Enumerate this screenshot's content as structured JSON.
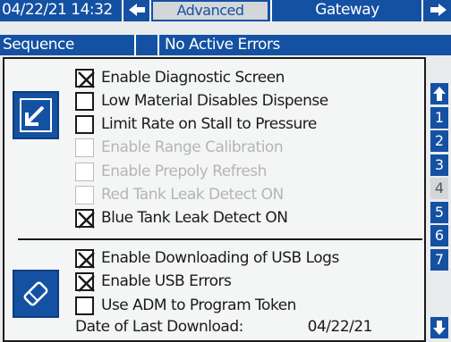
{
  "header": {
    "datetime": "04/22/21 14:32",
    "tab_active": "Advanced",
    "tab_next": "Gateway",
    "back_icon": "arrow-left-icon",
    "forward_icon": "arrow-right-icon"
  },
  "status": {
    "mode": "Sequence",
    "errors": "No Active Errors"
  },
  "settings": [
    {
      "label": "Enable Diagnostic Screen",
      "checked": true,
      "enabled": true
    },
    {
      "label": "Low Material Disables Dispense",
      "checked": false,
      "enabled": true
    },
    {
      "label": "Limit Rate on Stall to Pressure",
      "checked": false,
      "enabled": true
    },
    {
      "label": "Enable Range Calibration",
      "checked": false,
      "enabled": false
    },
    {
      "label": "Enable Prepoly Refresh",
      "checked": false,
      "enabled": false
    },
    {
      "label": "Red Tank Leak Detect ON",
      "checked": false,
      "enabled": false
    },
    {
      "label": "Blue Tank Leak Detect ON",
      "checked": true,
      "enabled": true
    },
    {
      "label": "Enable Downloading of USB Logs",
      "checked": true,
      "enabled": true
    },
    {
      "label": "Enable USB Errors",
      "checked": true,
      "enabled": true
    },
    {
      "label": "Use ADM to Program Token",
      "checked": false,
      "enabled": true
    }
  ],
  "last_download": {
    "label": "Date of Last Download:",
    "value": "04/22/21"
  },
  "side_buttons": [
    "edit-icon",
    "eraser-icon"
  ],
  "pager": {
    "pages": [
      "1",
      "2",
      "3",
      "4",
      "5",
      "6",
      "7"
    ],
    "current": "4",
    "up_icon": "arrow-up-icon",
    "down_icon": "arrow-down-icon"
  },
  "colors": {
    "accent": "#1451a3",
    "background": "#e9ebec",
    "disabled_text": "#b5b5b5"
  }
}
